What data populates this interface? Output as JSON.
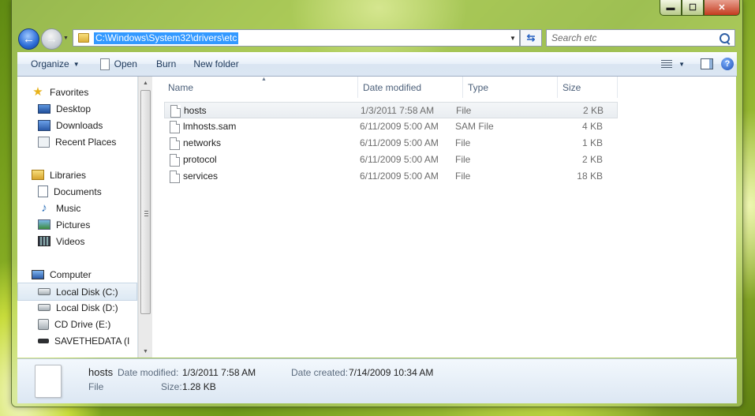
{
  "window": {
    "caption_buttons": {
      "minimize": "▬",
      "maximize": "☐",
      "close": "✕"
    }
  },
  "address_bar": {
    "path": "C:\\Windows\\System32\\drivers\\etc"
  },
  "search": {
    "placeholder": "Search etc"
  },
  "toolbar": {
    "organize": "Organize",
    "open": "Open",
    "burn": "Burn",
    "new_folder": "New folder",
    "help": "?"
  },
  "nav_pane": {
    "favorites": {
      "label": "Favorites",
      "items": [
        "Desktop",
        "Downloads",
        "Recent Places"
      ]
    },
    "libraries": {
      "label": "Libraries",
      "items": [
        "Documents",
        "Music",
        "Pictures",
        "Videos"
      ]
    },
    "computer": {
      "label": "Computer",
      "items": [
        "Local Disk (C:)",
        "Local Disk (D:)",
        "CD Drive (E:)",
        "SAVETHEDATA (I"
      ]
    }
  },
  "columns": {
    "name": "Name",
    "date": "Date modified",
    "type": "Type",
    "size": "Size"
  },
  "files": [
    {
      "name": "hosts",
      "date": "1/3/2011 7:58 AM",
      "type": "File",
      "size": "2 KB"
    },
    {
      "name": "lmhosts.sam",
      "date": "6/11/2009 5:00 AM",
      "type": "SAM File",
      "size": "4 KB"
    },
    {
      "name": "networks",
      "date": "6/11/2009 5:00 AM",
      "type": "File",
      "size": "1 KB"
    },
    {
      "name": "protocol",
      "date": "6/11/2009 5:00 AM",
      "type": "File",
      "size": "2 KB"
    },
    {
      "name": "services",
      "date": "6/11/2009 5:00 AM",
      "type": "File",
      "size": "18 KB"
    }
  ],
  "details": {
    "name": "hosts",
    "type": "File",
    "date_modified_label": "Date modified:",
    "date_modified": "1/3/2011 7:58 AM",
    "size_label": "Size:",
    "size": "1.28 KB",
    "date_created_label": "Date created:",
    "date_created": "7/14/2009 10:34 AM"
  }
}
